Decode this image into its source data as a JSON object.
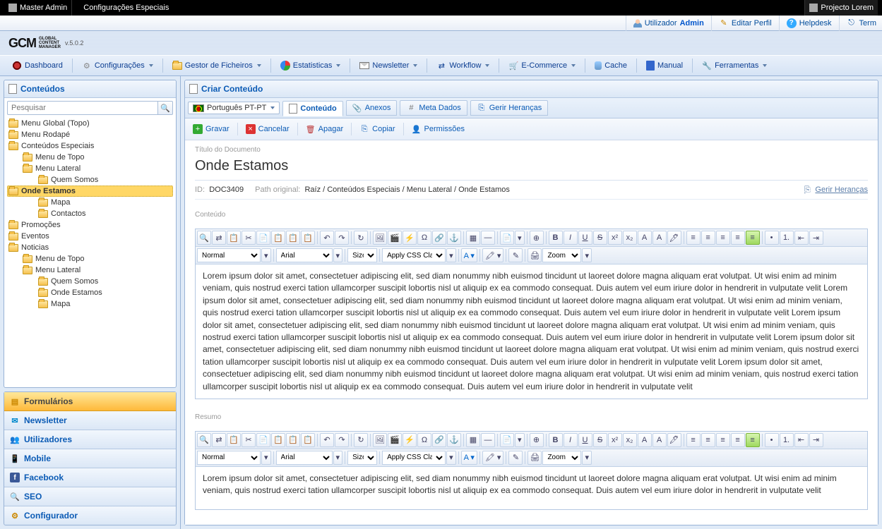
{
  "topbar": {
    "left": [
      "Master Admin",
      "Configurações Especiais"
    ],
    "right": "Projecto Lorem"
  },
  "userbar": {
    "user_prefix": "Utilizador",
    "user_name": "Admin",
    "edit_profile": "Editar Perfil",
    "helpdesk": "Helpdesk",
    "exit": "Term"
  },
  "logo": {
    "brand": "GCM",
    "sub1": "GLOBAL",
    "sub2": "CONTENT",
    "sub3": "MANAGER",
    "version": "v.5.0.2"
  },
  "mainmenu": [
    {
      "label": "Dashboard",
      "dd": false
    },
    {
      "label": "Configurações",
      "dd": true
    },
    {
      "label": "Gestor de Ficheiros",
      "dd": true
    },
    {
      "label": "Estatisticas",
      "dd": true
    },
    {
      "label": "Newsletter",
      "dd": true
    },
    {
      "label": "Workflow",
      "dd": true
    },
    {
      "label": "E-Commerce",
      "dd": true
    },
    {
      "label": "Cache",
      "dd": false
    },
    {
      "label": "Manual",
      "dd": false
    },
    {
      "label": "Ferramentas",
      "dd": true
    }
  ],
  "sidebar": {
    "contents_title": "Conteúdos",
    "search_placeholder": "Pesquisar",
    "tree": [
      {
        "l": "Menu Global (Topo)",
        "d": 0
      },
      {
        "l": "Menu Rodapé",
        "d": 0
      },
      {
        "l": "Conteúdos Especiais",
        "d": 0
      },
      {
        "l": "Menu de Topo",
        "d": 1
      },
      {
        "l": "Menu Lateral",
        "d": 1
      },
      {
        "l": "Quem Somos",
        "d": 2
      },
      {
        "l": "Onde Estamos",
        "d": 2,
        "sel": true
      },
      {
        "l": "Mapa",
        "d": 2
      },
      {
        "l": "Contactos",
        "d": 2
      },
      {
        "l": "Promoções",
        "d": 0
      },
      {
        "l": "Eventos",
        "d": 0
      },
      {
        "l": "Noticias",
        "d": 0
      },
      {
        "l": "Menu de Topo",
        "d": 1
      },
      {
        "l": "Menu Lateral",
        "d": 1
      },
      {
        "l": "Quem Somos",
        "d": 2
      },
      {
        "l": "Onde Estamos",
        "d": 2
      },
      {
        "l": "Mapa",
        "d": 2
      }
    ],
    "accordion": [
      "Formulários",
      "Newsletter",
      "Utilizadores",
      "Mobile",
      "Facebook",
      "SEO",
      "Configurador"
    ]
  },
  "content": {
    "panel_title": "Criar Conteúdo",
    "language": "Português PT-PT",
    "tabs": [
      "Conteúdo",
      "Anexos",
      "Meta Dados",
      "Gerir Heranças"
    ],
    "actions": {
      "save": "Gravar",
      "cancel": "Cancelar",
      "delete": "Apagar",
      "copy": "Copiar",
      "perm": "Permissões"
    },
    "title_label": "Título do Documento",
    "title_value": "Onde Estamos",
    "id_label": "ID:",
    "id_value": "DOC3409",
    "path_label": "Path original:",
    "path_value": "Raíz / Conteúdos Especiais / Menu Lateral / Onde Estamos",
    "inherit_link": "Gerir Heranças",
    "content_label": "Conteúdo",
    "summary_label": "Resumo",
    "editor": {
      "format": "Normal",
      "font": "Arial",
      "size": "Size",
      "css": "Apply CSS Class",
      "zoom": "Zoom"
    },
    "body_text": "Lorem ipsum dolor sit amet, consectetuer adipiscing elit, sed diam nonummy nibh euismod tincidunt ut laoreet dolore magna aliquam erat volutpat. Ut wisi enim ad minim veniam, quis nostrud exerci tation ullamcorper suscipit lobortis nisl ut aliquip ex ea commodo consequat. Duis autem vel eum iriure dolor in hendrerit in vulputate velit Lorem ipsum dolor sit amet, consectetuer adipiscing elit, sed diam nonummy nibh euismod tincidunt ut laoreet dolore magna aliquam erat volutpat. Ut wisi enim ad minim veniam, quis nostrud exerci tation ullamcorper suscipit lobortis nisl ut aliquip ex ea commodo consequat. Duis autem vel eum iriure dolor in hendrerit in vulputate velit Lorem ipsum dolor sit amet, consectetuer adipiscing elit, sed diam nonummy nibh euismod tincidunt ut laoreet dolore magna aliquam erat volutpat. Ut wisi enim ad minim veniam, quis nostrud exerci tation ullamcorper suscipit lobortis nisl ut aliquip ex ea commodo consequat. Duis autem vel eum iriure dolor in hendrerit in vulputate velit Lorem ipsum dolor sit amet, consectetuer adipiscing elit, sed diam nonummy nibh euismod tincidunt ut laoreet dolore magna aliquam erat volutpat. Ut wisi enim ad minim veniam, quis nostrud exerci tation ullamcorper suscipit lobortis nisl ut aliquip ex ea commodo consequat. Duis autem vel eum iriure dolor in hendrerit in vulputate velit Lorem ipsum dolor sit amet, consectetuer adipiscing elit, sed diam nonummy nibh euismod tincidunt ut laoreet dolore magna aliquam erat volutpat. Ut wisi enim ad minim veniam, quis nostrud exerci tation ullamcorper suscipit lobortis nisl ut aliquip ex ea commodo consequat. Duis autem vel eum iriure dolor in hendrerit in vulputate velit",
    "summary_text": "Lorem ipsum dolor sit amet, consectetuer adipiscing elit, sed diam nonummy nibh euismod tincidunt ut laoreet dolore magna aliquam erat volutpat. Ut wisi enim ad minim veniam, quis nostrud exerci tation ullamcorper suscipit lobortis nisl ut aliquip ex ea commodo consequat. Duis autem vel eum iriure dolor in hendrerit in vulputate velit"
  }
}
